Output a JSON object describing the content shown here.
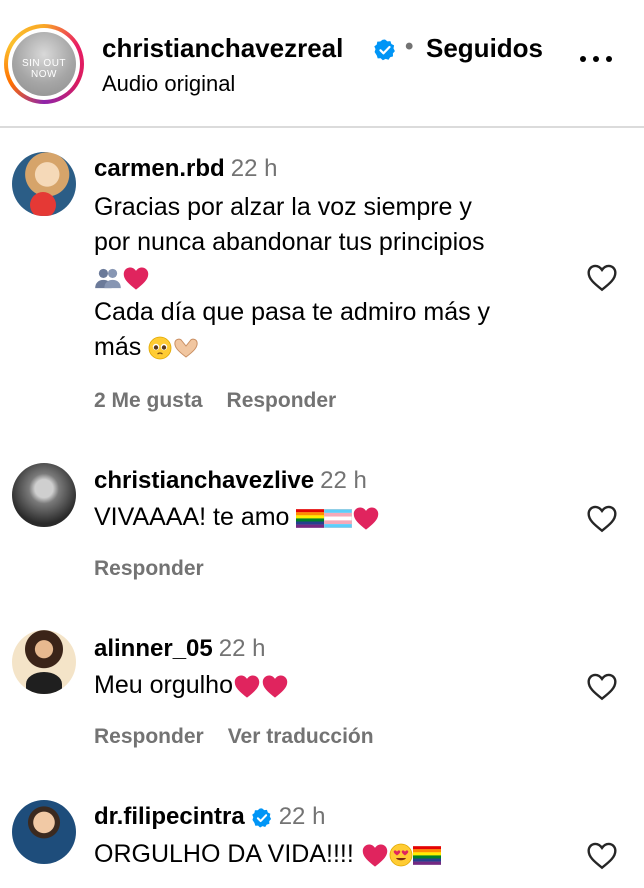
{
  "header": {
    "avatar_text": "SIN OUT NOW",
    "username": "christianchavezreal",
    "separator": "•",
    "follow_status": "Seguidos",
    "audio_label": "Audio original"
  },
  "comments": [
    {
      "username": "carmen.rbd",
      "time": "22 h",
      "lines": [
        "Gracias por alzar la voz siempre y",
        "por nunca abandonar tus principios"
      ],
      "lines2": [
        "Cada día que pasa te admiro más y",
        "más"
      ],
      "actions": [
        "2 Me gusta",
        "Responder"
      ]
    },
    {
      "username": "christianchavezlive",
      "time": "22 h",
      "text": "VIVAAAA! te amo",
      "actions": [
        "Responder"
      ]
    },
    {
      "username": "alinner_05",
      "time": "22 h",
      "text": "Meu orgulho",
      "actions": [
        "Responder",
        "Ver traducción"
      ]
    },
    {
      "username": "dr.filipecintra",
      "time": "22 h",
      "text": "ORGULHO DA VIDA!!!!",
      "actions": []
    }
  ],
  "icons": {
    "verified": "verified-badge-icon",
    "heart": "heart-outline-icon",
    "more": "more-options-icon"
  },
  "colors": {
    "verified": "#0095f6",
    "secondary_text": "#737373",
    "divider": "#dbdbdb",
    "red_heart": "#e0245e"
  }
}
